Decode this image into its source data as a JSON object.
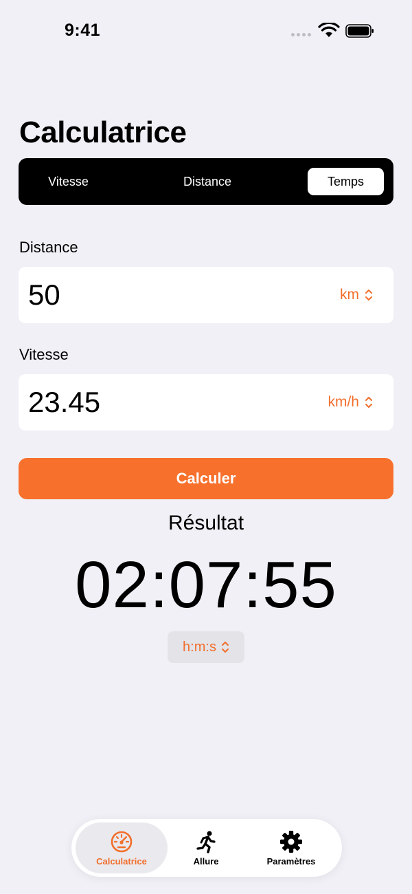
{
  "status_bar": {
    "time": "9:41"
  },
  "page": {
    "title": "Calculatrice"
  },
  "segments": [
    {
      "label": "Vitesse",
      "selected": false
    },
    {
      "label": "Distance",
      "selected": false
    },
    {
      "label": "Temps",
      "selected": true
    }
  ],
  "fields": {
    "distance": {
      "label": "Distance",
      "value": "50",
      "unit": "km"
    },
    "speed": {
      "label": "Vitesse",
      "value": "23.45",
      "unit": "km/h"
    }
  },
  "calculate_button": {
    "label": "Calculer"
  },
  "result": {
    "label": "Résultat",
    "value": "02:07:55",
    "format": "h:m:s"
  },
  "tab_bar": {
    "items": [
      {
        "label": "Calculatrice",
        "icon": "speedometer-icon",
        "selected": true
      },
      {
        "label": "Allure",
        "icon": "runner-icon",
        "selected": false
      },
      {
        "label": "Paramètres",
        "icon": "gear-icon",
        "selected": false
      }
    ]
  },
  "colors": {
    "accent": "#F26E2B",
    "button": "#F7702C",
    "background": "#F1F0F6",
    "segmented_bg": "#000000"
  }
}
